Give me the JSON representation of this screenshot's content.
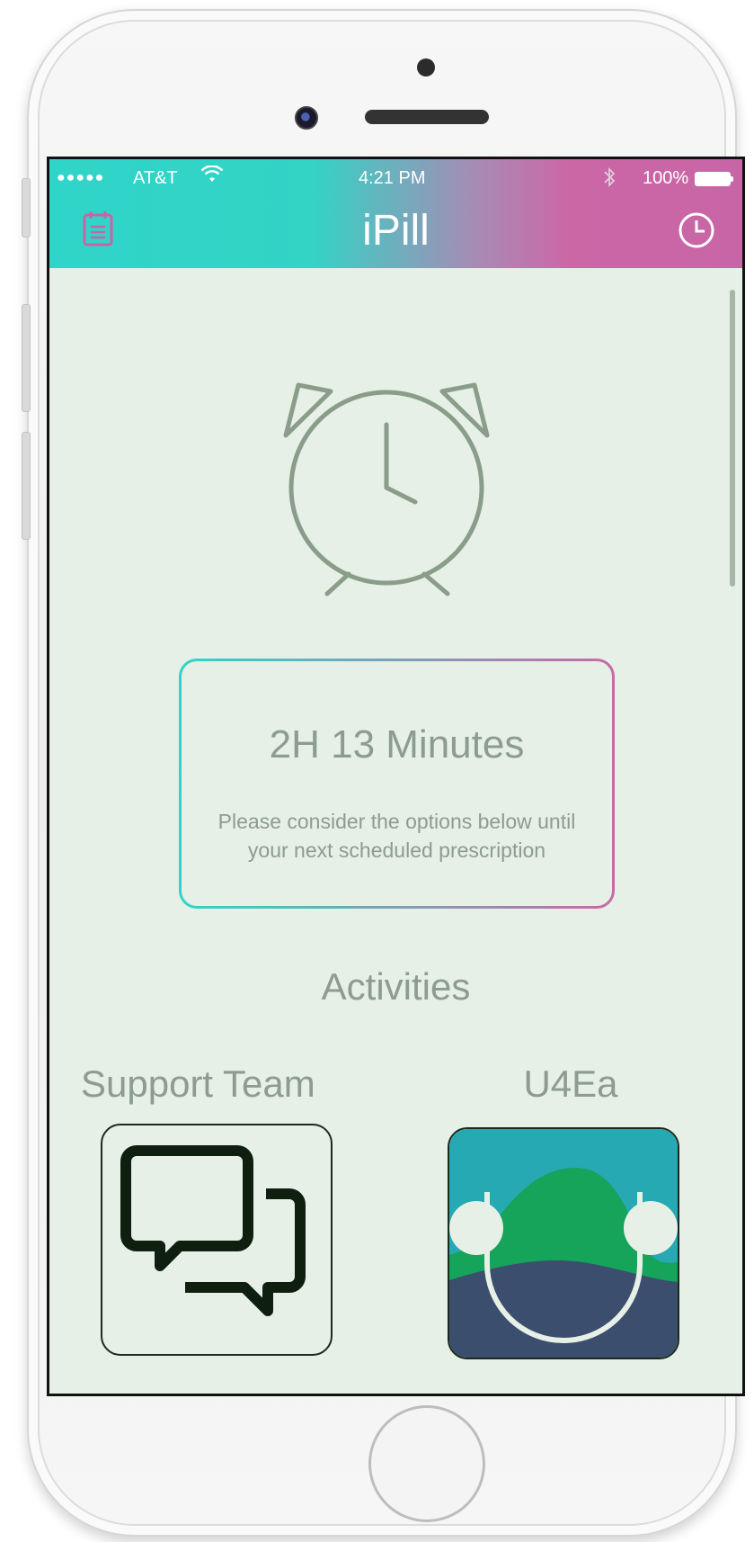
{
  "status_bar": {
    "signal": "●●●●●",
    "carrier": "AT&T",
    "time": "4:21 PM",
    "battery": "100%"
  },
  "header": {
    "title": "iPill",
    "left_icon": "calendar-icon",
    "right_icon": "clock-icon"
  },
  "timer": {
    "remaining": "2H 13 Minutes",
    "message": "Please consider the options below until your next scheduled prescription"
  },
  "activities": {
    "heading": "Activities",
    "items": [
      {
        "label": "Support Team",
        "icon": "chat-bubbles-icon"
      },
      {
        "label": "U4Ea",
        "icon": "headphones-landscape-icon"
      }
    ]
  },
  "colors": {
    "gradient_start": "#2fd5c8",
    "gradient_end": "#c865a6",
    "background": "#e6f0e6",
    "text_muted": "#8c9c8e"
  }
}
